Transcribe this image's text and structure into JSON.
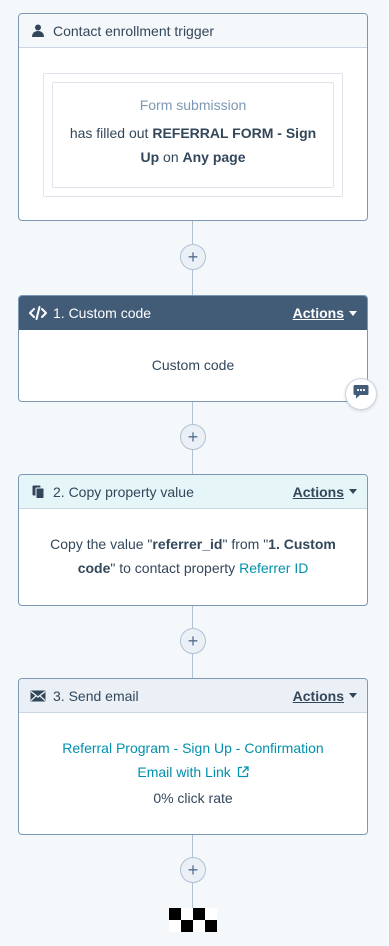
{
  "trigger": {
    "title": "Contact enrollment trigger",
    "subtitle": "Form submission",
    "pre": "has filled out ",
    "form": "REFERRAL FORM - Sign Up",
    "mid": " on ",
    "page": "Any page"
  },
  "steps": [
    {
      "title": "1. Custom code",
      "actions_label": "Actions",
      "body": "Custom code"
    },
    {
      "title": "2. Copy property value",
      "actions_label": "Actions",
      "p1": "Copy the value \"",
      "prop": "referrer_id",
      "p2": "\" from \"",
      "src": "1. Custom code",
      "p3": "\" to contact property ",
      "target": "Referrer ID"
    },
    {
      "title": "3. Send email",
      "actions_label": "Actions",
      "email_link": "Referral Program - Sign Up - Confirmation Email with Link",
      "stat": "0% click rate"
    }
  ],
  "add_symbol": "+",
  "colors": {
    "border": "#7c98b6",
    "custom_code_header": "#425b76",
    "copy_header": "#e5f5f8",
    "link": "#0091ae",
    "background": "#f5f8fa"
  },
  "icons": [
    "person-icon",
    "code-icon",
    "copy-icon",
    "envelope-icon",
    "comment-icon",
    "external-link-icon",
    "add-icon"
  ]
}
